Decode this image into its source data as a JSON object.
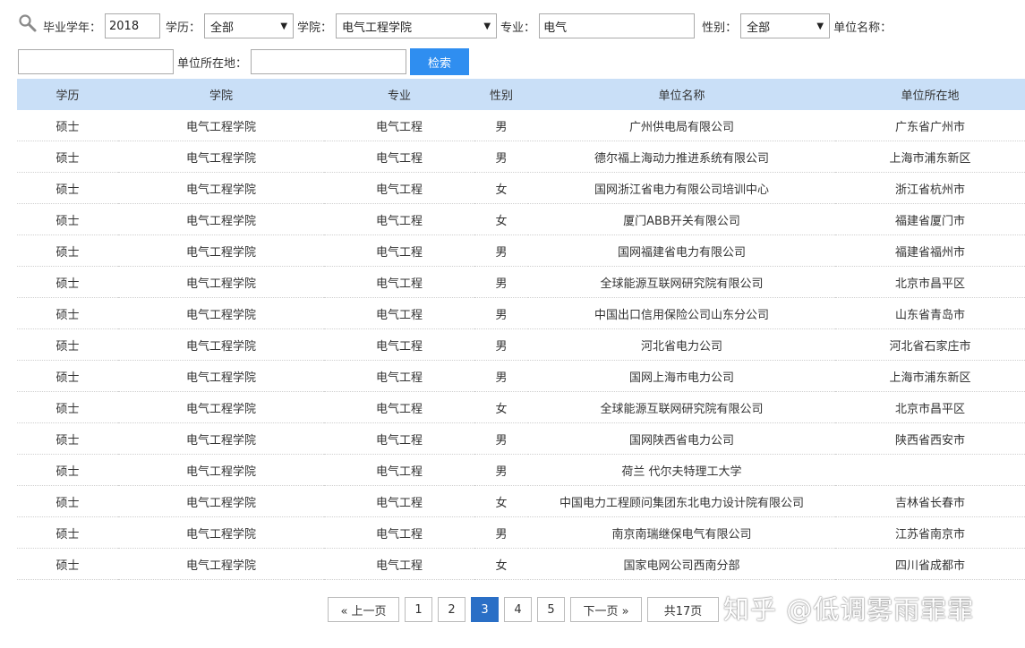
{
  "filters": {
    "year_label": "毕业学年：",
    "year_value": "2018",
    "degree_label": "学历：",
    "degree_value": "全部",
    "college_label": "学院：",
    "college_value": "电气工程学院",
    "major_label": "专业：",
    "major_value": "电气",
    "gender_label": "性别：",
    "gender_value": "全部",
    "company_label": "单位名称：",
    "company_value": "",
    "location_label": "单位所在地：",
    "location_value": "",
    "search_button": "检索"
  },
  "table": {
    "headers": [
      "学历",
      "学院",
      "专业",
      "性别",
      "单位名称",
      "单位所在地"
    ],
    "rows": [
      [
        "硕士",
        "电气工程学院",
        "电气工程",
        "男",
        "广州供电局有限公司",
        "广东省广州市"
      ],
      [
        "硕士",
        "电气工程学院",
        "电气工程",
        "男",
        "德尔福上海动力推进系统有限公司",
        "上海市浦东新区"
      ],
      [
        "硕士",
        "电气工程学院",
        "电气工程",
        "女",
        "国网浙江省电力有限公司培训中心",
        "浙江省杭州市"
      ],
      [
        "硕士",
        "电气工程学院",
        "电气工程",
        "女",
        "厦门ABB开关有限公司",
        "福建省厦门市"
      ],
      [
        "硕士",
        "电气工程学院",
        "电气工程",
        "男",
        "国网福建省电力有限公司",
        "福建省福州市"
      ],
      [
        "硕士",
        "电气工程学院",
        "电气工程",
        "男",
        "全球能源互联网研究院有限公司",
        "北京市昌平区"
      ],
      [
        "硕士",
        "电气工程学院",
        "电气工程",
        "男",
        "中国出口信用保险公司山东分公司",
        "山东省青岛市"
      ],
      [
        "硕士",
        "电气工程学院",
        "电气工程",
        "男",
        "河北省电力公司",
        "河北省石家庄市"
      ],
      [
        "硕士",
        "电气工程学院",
        "电气工程",
        "男",
        "国网上海市电力公司",
        "上海市浦东新区"
      ],
      [
        "硕士",
        "电气工程学院",
        "电气工程",
        "女",
        "全球能源互联网研究院有限公司",
        "北京市昌平区"
      ],
      [
        "硕士",
        "电气工程学院",
        "电气工程",
        "男",
        "国网陕西省电力公司",
        "陕西省西安市"
      ],
      [
        "硕士",
        "电气工程学院",
        "电气工程",
        "男",
        "荷兰 代尔夫特理工大学",
        ""
      ],
      [
        "硕士",
        "电气工程学院",
        "电气工程",
        "女",
        "中国电力工程顾问集团东北电力设计院有限公司",
        "吉林省长春市"
      ],
      [
        "硕士",
        "电气工程学院",
        "电气工程",
        "男",
        "南京南瑞继保电气有限公司",
        "江苏省南京市"
      ],
      [
        "硕士",
        "电气工程学院",
        "电气工程",
        "女",
        "国家电网公司西南分部",
        "四川省成都市"
      ]
    ]
  },
  "pagination": {
    "prev": "« 上一页",
    "pages": [
      "1",
      "2",
      "3",
      "4",
      "5"
    ],
    "current": "3",
    "next": "下一页 »",
    "total": "共17页"
  },
  "watermark": "知乎 @低调雾雨霏霏",
  "colors": {
    "header_bg": "#c9dff7",
    "button_bg": "#2f8ef0",
    "active_page_bg": "#2a6fc6"
  }
}
